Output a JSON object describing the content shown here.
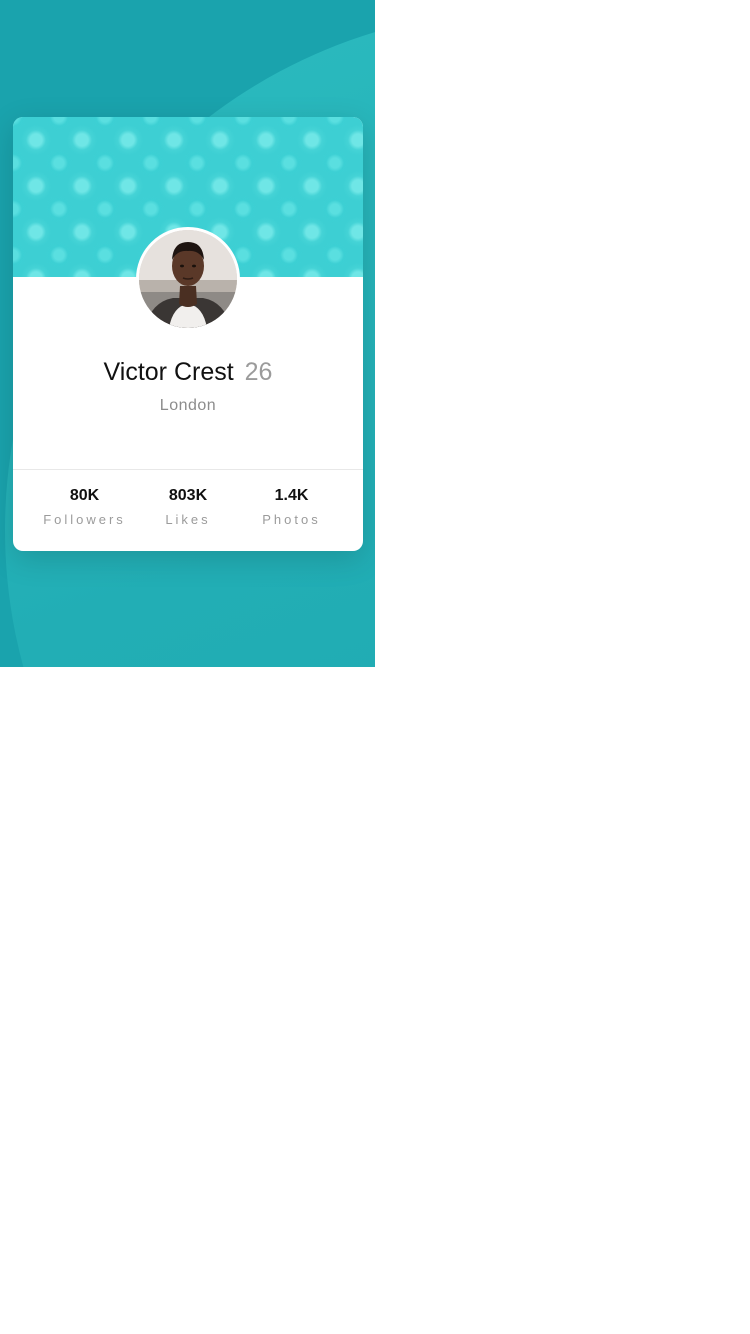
{
  "profile": {
    "name": "Victor Crest",
    "age": "26",
    "city": "London"
  },
  "stats": [
    {
      "value": "80K",
      "label": "Followers"
    },
    {
      "value": "803K",
      "label": "Likes"
    },
    {
      "value": "1.4K",
      "label": "Photos"
    }
  ],
  "colors": {
    "background": "#1aa3ad",
    "header_pattern": "#3dcfd3",
    "card": "#ffffff"
  }
}
